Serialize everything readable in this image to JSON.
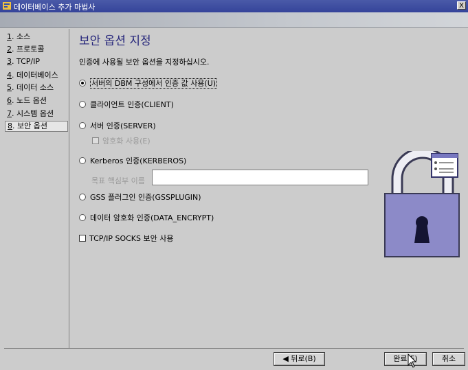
{
  "window": {
    "title": "데이터베이스 추가 마법사",
    "close_label": "X"
  },
  "sidebar": {
    "items": [
      {
        "num": "1",
        "label": ". 소스"
      },
      {
        "num": "2",
        "label": ". 프로토콜"
      },
      {
        "num": "3",
        "label": ". TCP/IP"
      },
      {
        "num": "4",
        "label": ". 데이터베이스"
      },
      {
        "num": "5",
        "label": ". 데이터 소스"
      },
      {
        "num": "6",
        "label": ". 노드 옵션"
      },
      {
        "num": "7",
        "label": ". 시스템 옵션"
      },
      {
        "num": "8",
        "label": ". 보안 옵션"
      }
    ],
    "active_index": 7
  },
  "main": {
    "title": "보안 옵션 지정",
    "description": "인증에 사용될 보안 옵션을 지정하십시오.",
    "options": {
      "server_dbm": "서버의 DBM 구성에서 인증 값 사용(U)",
      "client": "클라이언트 인증(CLIENT)",
      "server": "서버 인증(SERVER)",
      "encryption": "암호화 사용(E)",
      "kerberos": "Kerberos 인증(KERBEROS)",
      "principal_label": "목표 핵심부 이름",
      "principal_value": "",
      "gss": "GSS 플러그인 인증(GSSPLUGIN)",
      "data_encrypt": "데이터 암호화 인증(DATA_ENCRYPT)",
      "socks": "TCP/IP SOCKS 보안 사용"
    },
    "selected_option": "server_dbm"
  },
  "footer": {
    "back_label": "◀ 뒤로(B)",
    "finish_label": "완료(F)",
    "cancel_label": "취소"
  },
  "colors": {
    "title_bar": "#3c4ba0",
    "heading": "#24247a",
    "lock_body": "#8a88c6",
    "lock_shackle": "#eaeaf2"
  },
  "icons": {
    "app": "wizard-window-icon",
    "lock": "padlock-security-icon",
    "cursor": "mouse-pointer-icon"
  }
}
